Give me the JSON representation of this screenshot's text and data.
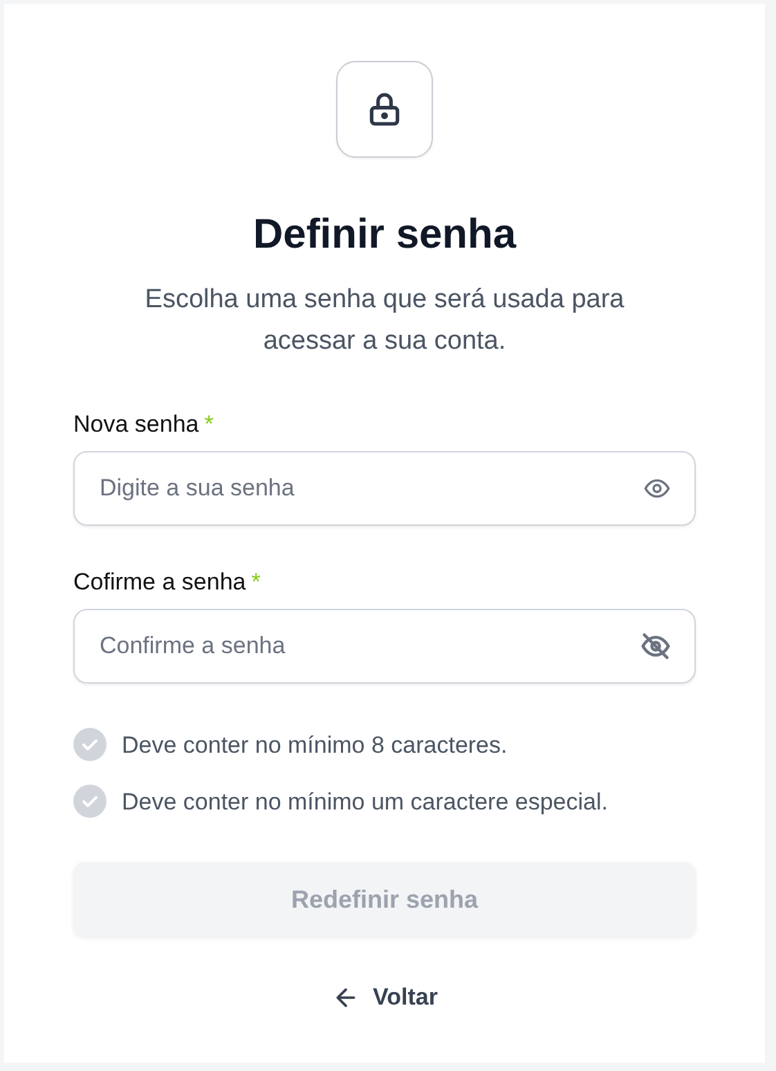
{
  "title": "Definir senha",
  "subtitle": "Escolha uma senha que será usada para acessar a sua conta.",
  "fields": [
    {
      "label": "Nova senha",
      "required": true,
      "placeholder": "Digite a sua senha",
      "hidden": false
    },
    {
      "label": "Cofirme a senha",
      "required": true,
      "placeholder": "Confirme a senha",
      "hidden": true
    }
  ],
  "required_mark": "*",
  "requirements": [
    {
      "text": "Deve conter no mínimo 8 caracteres.",
      "met": false
    },
    {
      "text": "Deve conter no mínimo um caractere especial.",
      "met": false
    }
  ],
  "submit": {
    "label": "Redefinir senha",
    "disabled": true
  },
  "back": {
    "label": "Voltar"
  }
}
